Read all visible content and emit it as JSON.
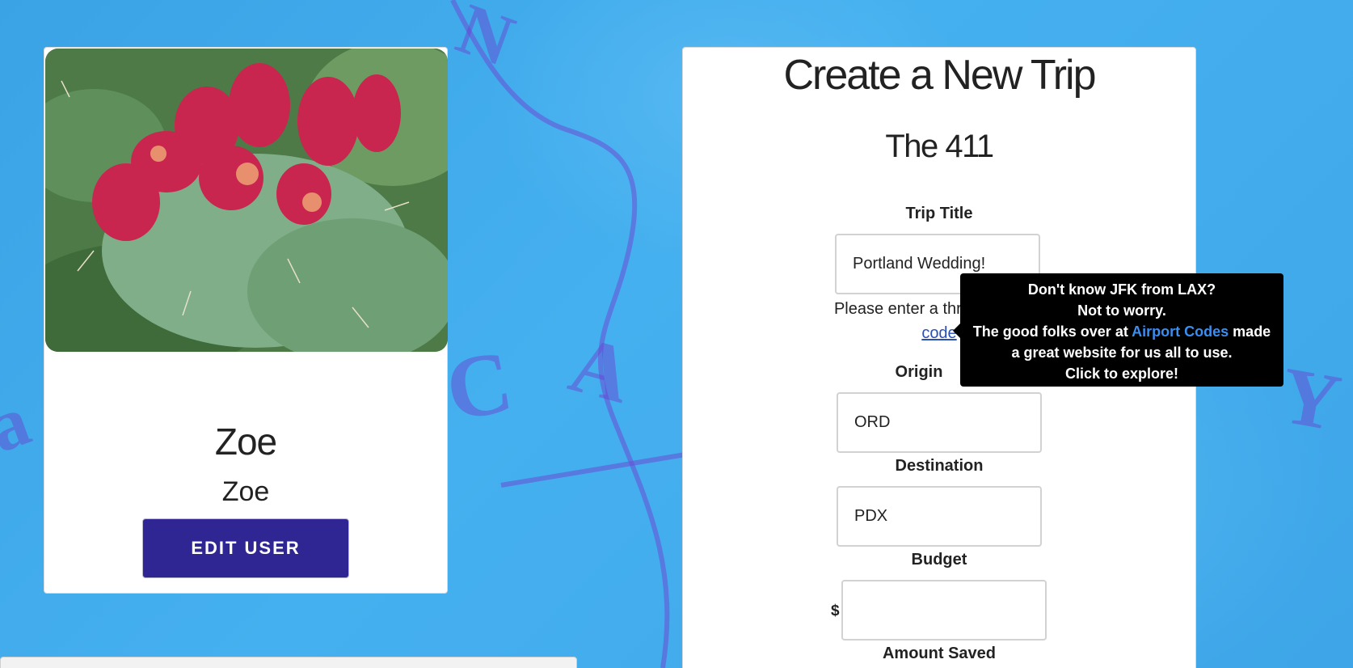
{
  "profile": {
    "photo_alt": "prickly pear cactus",
    "name": "Zoe",
    "username": "Zoe",
    "edit_button": "EDIT USER"
  },
  "form": {
    "title": "Create a New Trip",
    "subtitle": "The 411",
    "trip_title": {
      "label": "Trip Title",
      "value": "Portland Wedding!"
    },
    "help": {
      "prefix": "Please enter a three",
      "link": "code"
    },
    "origin": {
      "label": "Origin",
      "value": "ORD"
    },
    "destination": {
      "label": "Destination",
      "value": "PDX"
    },
    "budget": {
      "label": "Budget",
      "currency": "$",
      "value": ""
    },
    "amount_saved": {
      "label": "Amount Saved"
    }
  },
  "tooltip": {
    "line1": "Don't know JFK from LAX?",
    "line2": "Not to worry.",
    "line3_prefix": "The good folks over at ",
    "line3_link": "Airport Codes",
    "line3_suffix": " made",
    "line4": "a great website for us all to use.",
    "line5": "Click to explore!"
  },
  "colors": {
    "background": "#3fa9ea",
    "button": "#2f2694",
    "link": "#2a4fb5",
    "tooltip_link": "#3b8df0"
  }
}
